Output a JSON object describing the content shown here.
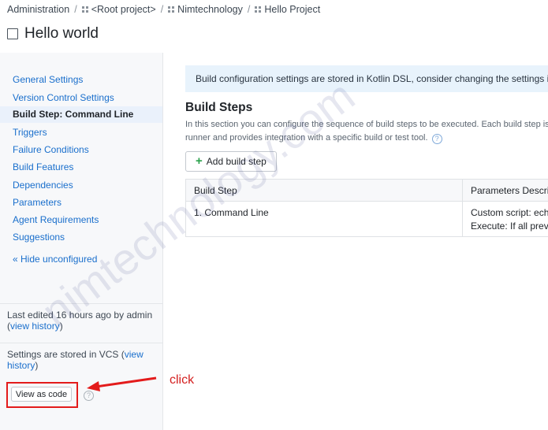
{
  "breadcrumb": {
    "items": [
      "Administration",
      "<Root project>",
      "Nimtechnology",
      "Hello Project"
    ],
    "separator": "/"
  },
  "page": {
    "title": "Hello world"
  },
  "sidebar": {
    "items": [
      {
        "label": "General Settings"
      },
      {
        "label": "Version Control Settings"
      },
      {
        "label": "Build Step: Command Line",
        "active": true
      },
      {
        "label": "Triggers"
      },
      {
        "label": "Failure Conditions"
      },
      {
        "label": "Build Features"
      },
      {
        "label": "Dependencies"
      },
      {
        "label": "Parameters"
      },
      {
        "label": "Agent Requirements"
      },
      {
        "label": "Suggestions"
      }
    ],
    "hide_unconfigured": "« Hide unconfigured",
    "last_edited_prefix": "Last edited 16 hours ago by admin",
    "view_history": "view history",
    "vcs_prefix": "Settings are stored in VCS",
    "vcs_view": "view",
    "vcs_history": "history",
    "view_as_code": "View as code",
    "help_glyph": "?"
  },
  "annotation": {
    "text": "click",
    "color": "#e31b1b"
  },
  "main": {
    "banner": "Build configuration settings are stored in Kotlin DSL, consider changing the settings in t",
    "steps_title": "Build Steps",
    "steps_desc_line1": "In this section you can configure the sequence of build steps to be executed. Each build step is repr",
    "steps_desc_line2": "runner and provides integration with a specific build or test tool.",
    "add_button": "Add build step",
    "table": {
      "headers": [
        "Build Step",
        "Parameters Descrip"
      ],
      "rows": [
        {
          "step": "1. Command Line",
          "params": [
            "Custom script: echo",
            "Execute: If all previ"
          ]
        }
      ]
    }
  },
  "watermark": "nimtechnology.com",
  "colors": {
    "link": "#1a6fcc",
    "banner_bg": "#e8f3fc",
    "accent_green": "#2aa14b"
  }
}
